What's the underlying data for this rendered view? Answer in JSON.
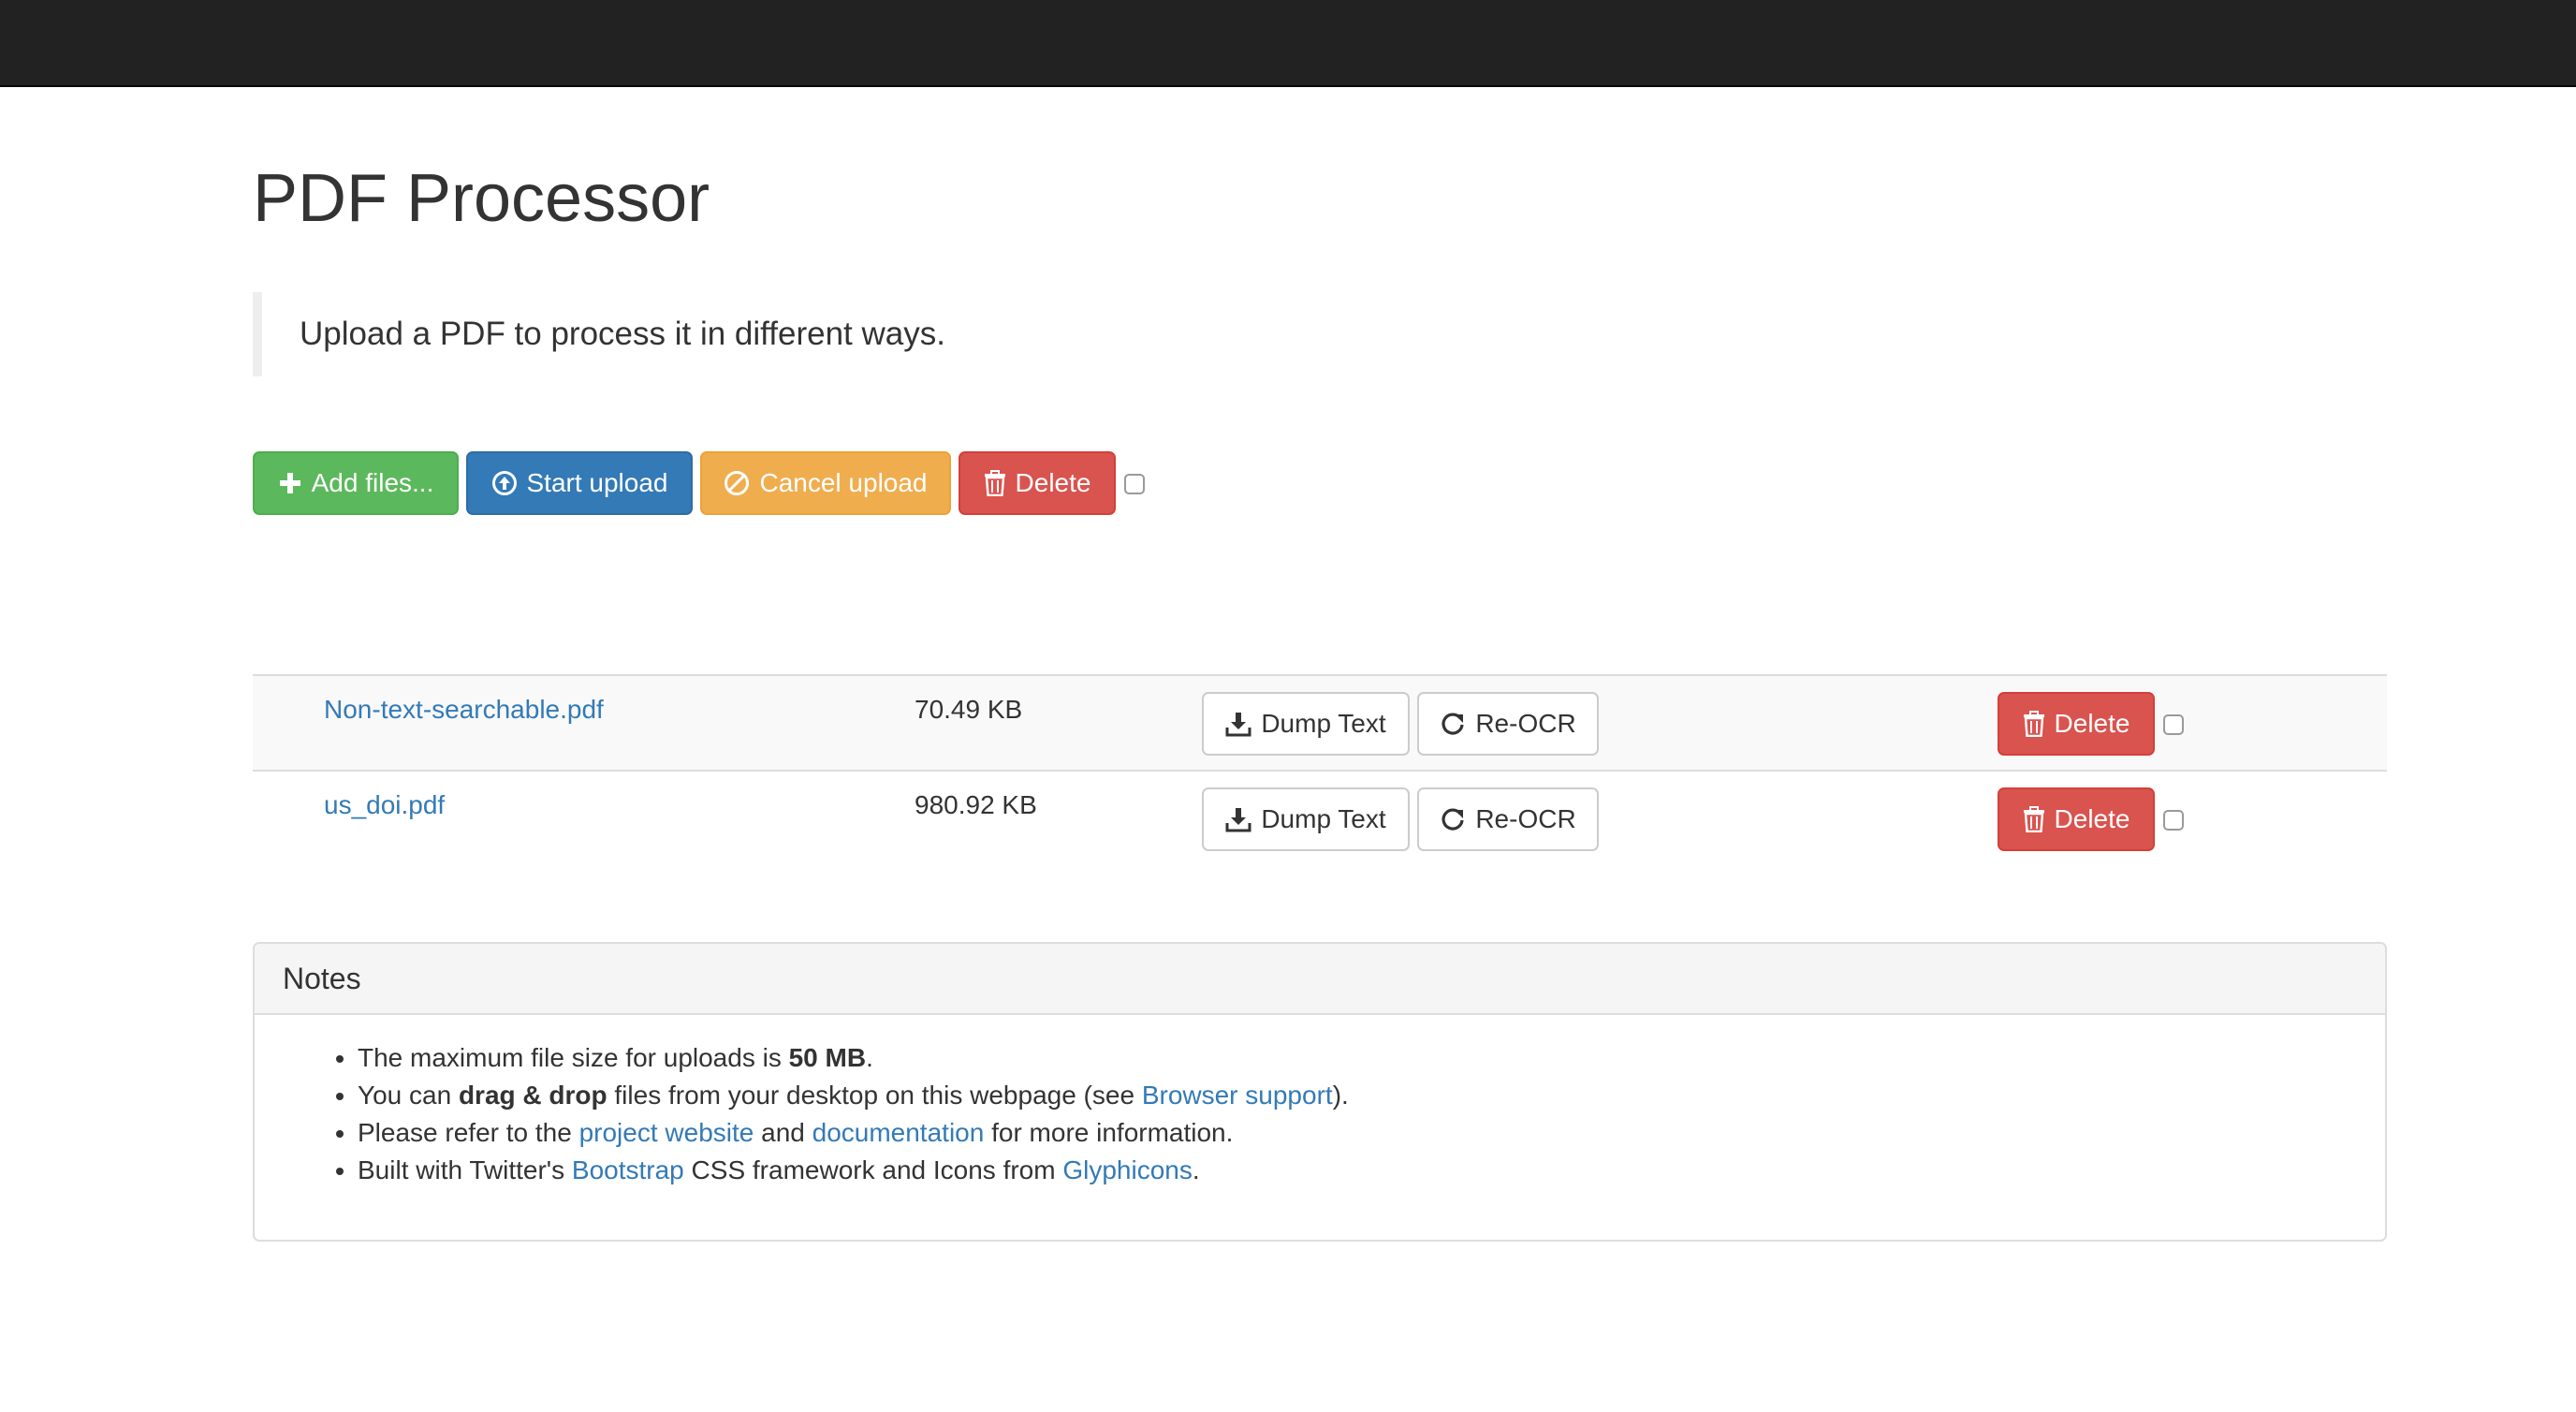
{
  "page": {
    "title": "PDF Processor",
    "lead": "Upload a PDF to process it in different ways."
  },
  "toolbar": {
    "add_files_label": "Add files...",
    "start_upload_label": "Start upload",
    "cancel_upload_label": "Cancel upload",
    "delete_label": "Delete"
  },
  "files": [
    {
      "name": "Non-text-searchable.pdf",
      "size": "70.49 KB",
      "dump_label": "Dump Text",
      "reocr_label": "Re-OCR",
      "delete_label": "Delete"
    },
    {
      "name": "us_doi.pdf",
      "size": "980.92 KB",
      "dump_label": "Dump Text",
      "reocr_label": "Re-OCR",
      "delete_label": "Delete"
    }
  ],
  "notes": {
    "heading": "Notes",
    "items": [
      {
        "p1": "The maximum file size for uploads is ",
        "b1": "50 MB",
        "p2": "."
      },
      {
        "p1": "You can ",
        "b1": "drag & drop",
        "p2": " files from your desktop on this webpage (see ",
        "a1": "Browser support",
        "p3": ")."
      },
      {
        "p1": "Please refer to the ",
        "a1": "project website",
        "p2": " and ",
        "a2": "documentation",
        "p3": " for more information."
      },
      {
        "p1": "Built with Twitter's ",
        "a1": "Bootstrap",
        "p2": " CSS framework and Icons from ",
        "a2": "Glyphicons",
        "p3": "."
      }
    ]
  },
  "colors": {
    "navbar": "#222222",
    "success": "#5cb85c",
    "primary": "#337ab7",
    "warning": "#f0ad4e",
    "danger": "#d9534f",
    "link": "#337ab7"
  },
  "icons": {
    "add": "plus-icon",
    "upload": "circle-arrow-up-icon",
    "cancel": "ban-circle-icon",
    "delete": "trash-icon",
    "dump": "download-icon",
    "reocr": "refresh-icon"
  }
}
